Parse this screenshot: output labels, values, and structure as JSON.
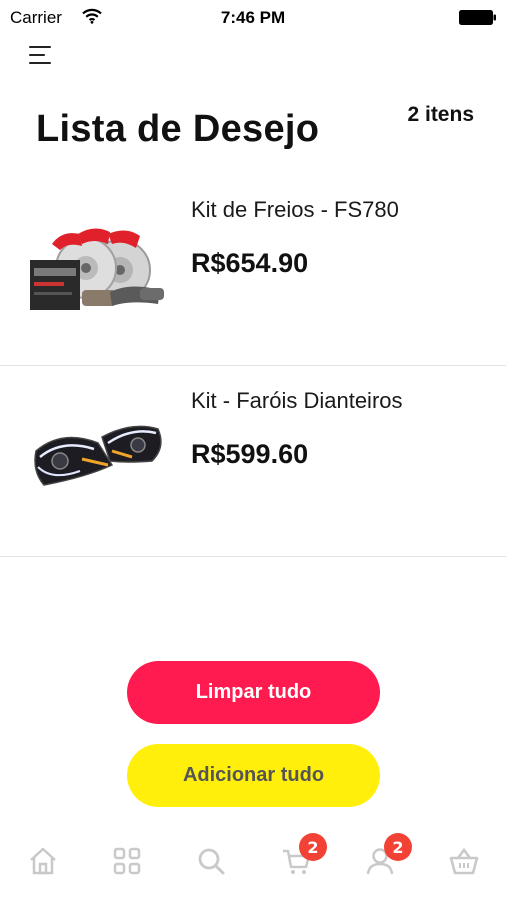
{
  "status_bar": {
    "carrier": "Carrier",
    "time": "7:46 PM"
  },
  "header": {
    "title": "Lista de Desejo",
    "item_count": "2 itens",
    "menu_icon": "hamburger-menu-icon"
  },
  "products": [
    {
      "name": "Kit de Freios - FS780",
      "price": "R$654.90",
      "image": "brake-kit-image"
    },
    {
      "name": "Kit - Faróis Dianteiros",
      "price": "R$599.60",
      "image": "headlights-image"
    }
  ],
  "actions": {
    "clear_label": "Limpar tudo",
    "add_label": "Adicionar tudo"
  },
  "tab_bar": {
    "items": [
      {
        "icon": "home-icon"
      },
      {
        "icon": "grid-icon"
      },
      {
        "icon": "search-icon"
      },
      {
        "icon": "cart-icon",
        "badge": "2"
      },
      {
        "icon": "user-icon",
        "badge": "2"
      },
      {
        "icon": "basket-icon"
      }
    ]
  },
  "colors": {
    "clear_button": "#ff1a4f",
    "add_button": "#ffef0a",
    "badge": "#f24236",
    "tab_icon": "#c9c9c9"
  }
}
